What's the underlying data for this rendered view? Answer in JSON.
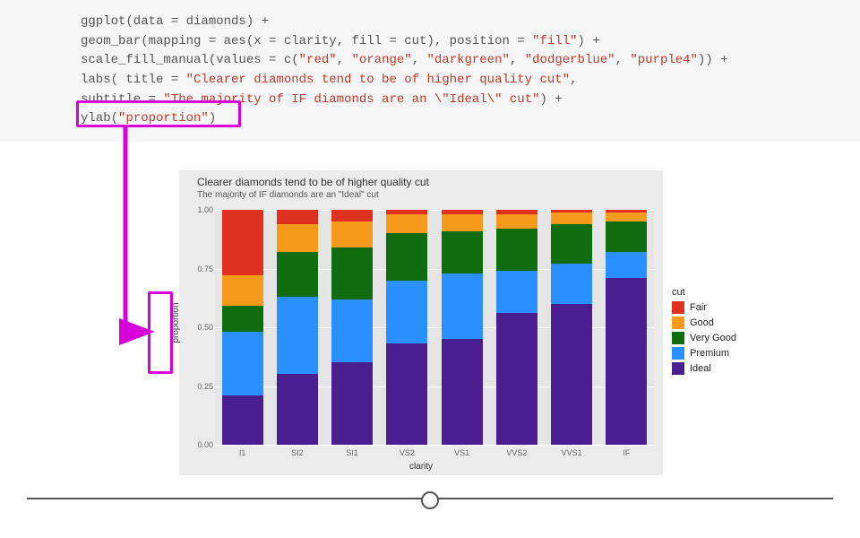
{
  "code": {
    "l1a": "ggplot(data = diamonds) +",
    "l2a": "  geom_bar(mapping = aes(x = clarity, fill = cut), position = ",
    "l2s": "\"fill\"",
    "l2b": ") +",
    "l3a": "  scale_fill_manual(values = c(",
    "l3s1": "\"red\"",
    "l3s2": "\"orange\"",
    "l3s3": "\"darkgreen\"",
    "l3s4": "\"dodgerblue\"",
    "l3s5": "\"purple4\"",
    "l3b": ")) +",
    "l4a": "  labs( title = ",
    "l4s": "\"Clearer diamonds tend to be of higher quality cut\"",
    "l4b": ",",
    "l5a": "        subtitle = ",
    "l5s": "\"The majority of IF diamonds are an \\\"Ideal\\\" cut\"",
    "l5b": ") +",
    "l6a": "  ylab(",
    "l6s": "\"proportion\"",
    "l6b": ")"
  },
  "chart_data": {
    "type": "bar",
    "stacking": "fill",
    "title": "Clearer diamonds tend to be of higher quality cut",
    "subtitle": "The majority of IF diamonds are an \"Ideal\" cut",
    "xlabel": "clarity",
    "ylabel": "proportion",
    "ylim": [
      0,
      1
    ],
    "yticks": [
      0.0,
      0.25,
      0.5,
      0.75,
      1.0
    ],
    "categories": [
      "I1",
      "SI2",
      "SI1",
      "VS2",
      "VS1",
      "VVS2",
      "VVS1",
      "IF"
    ],
    "legend_title": "cut",
    "series": [
      {
        "name": "Fair",
        "color": "#e03020",
        "values": [
          0.28,
          0.06,
          0.05,
          0.02,
          0.02,
          0.02,
          0.01,
          0.01
        ]
      },
      {
        "name": "Good",
        "color": "#f59a1b",
        "values": [
          0.13,
          0.12,
          0.11,
          0.08,
          0.07,
          0.06,
          0.05,
          0.04
        ]
      },
      {
        "name": "Very Good",
        "color": "#0f6d0f",
        "values": [
          0.11,
          0.19,
          0.22,
          0.2,
          0.18,
          0.18,
          0.17,
          0.13
        ]
      },
      {
        "name": "Premium",
        "color": "#2a90ff",
        "values": [
          0.27,
          0.33,
          0.27,
          0.27,
          0.28,
          0.18,
          0.17,
          0.11
        ]
      },
      {
        "name": "Ideal",
        "color": "#4b1e8f",
        "values": [
          0.21,
          0.3,
          0.35,
          0.43,
          0.45,
          0.56,
          0.6,
          0.71
        ]
      }
    ]
  },
  "ytick_labels": [
    "0.00",
    "0.25",
    "0.50",
    "0.75",
    "1.00"
  ]
}
